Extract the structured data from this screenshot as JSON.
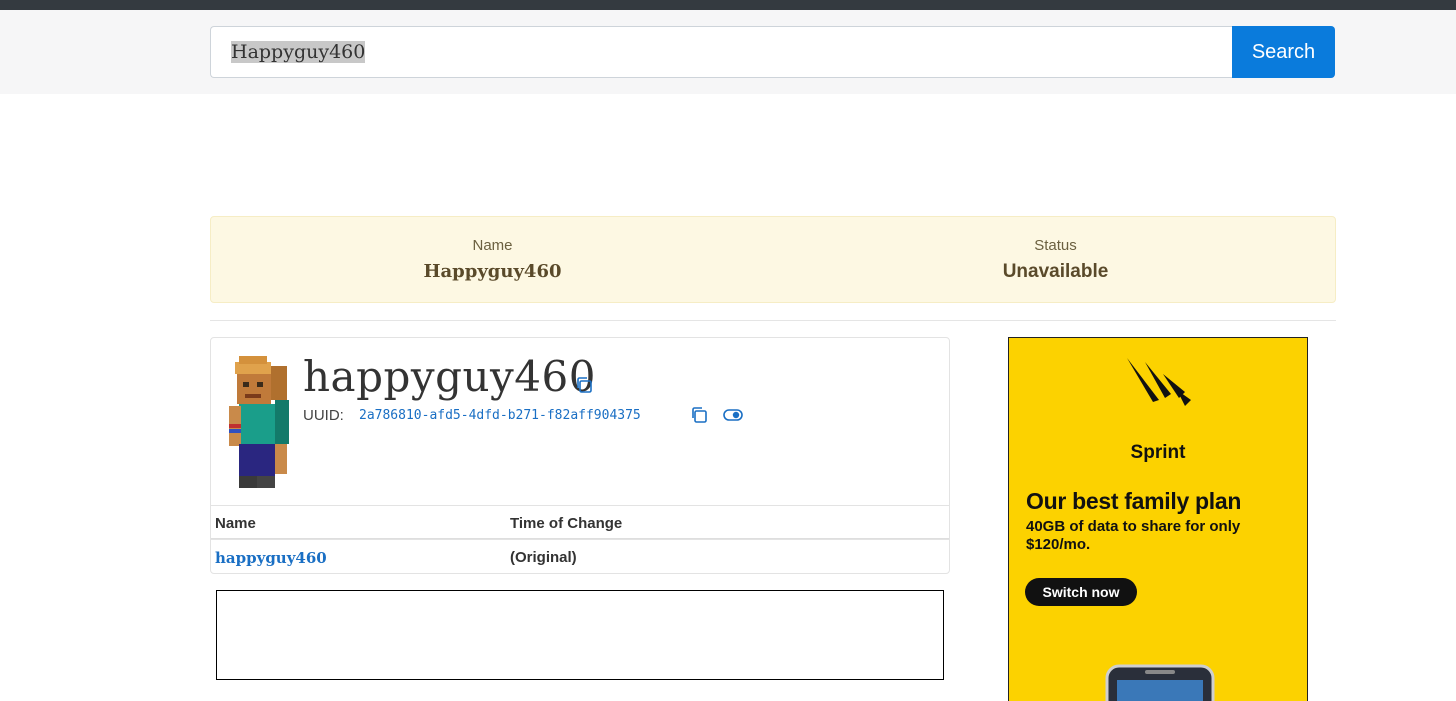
{
  "search": {
    "value": "Happyguy460",
    "button_label": "Search"
  },
  "status": {
    "name_label": "Name",
    "name_value": "Happyguy460",
    "status_label": "Status",
    "status_value": "Unavailable"
  },
  "profile": {
    "username": "happyguy460",
    "uuid_label": "UUID:",
    "uuid": "2a786810-afd5-4dfd-b271-f82aff904375",
    "icons": [
      "copy-icon",
      "copy-icon",
      "toggle-icon"
    ]
  },
  "history": {
    "columns": [
      "Name",
      "Time of Change"
    ],
    "rows": [
      {
        "name": "happyguy460",
        "time": "(Original)"
      }
    ]
  },
  "ad": {
    "brand": "Sprint",
    "headline": "Our best family plan",
    "subtext": "40GB of data to share for only $120/mo.",
    "cta": "Switch now",
    "accent": "#fcd200"
  },
  "colors": {
    "primary": "#0a7bdc",
    "link": "#1a6fc4",
    "alert_bg": "#fdf8e3"
  }
}
